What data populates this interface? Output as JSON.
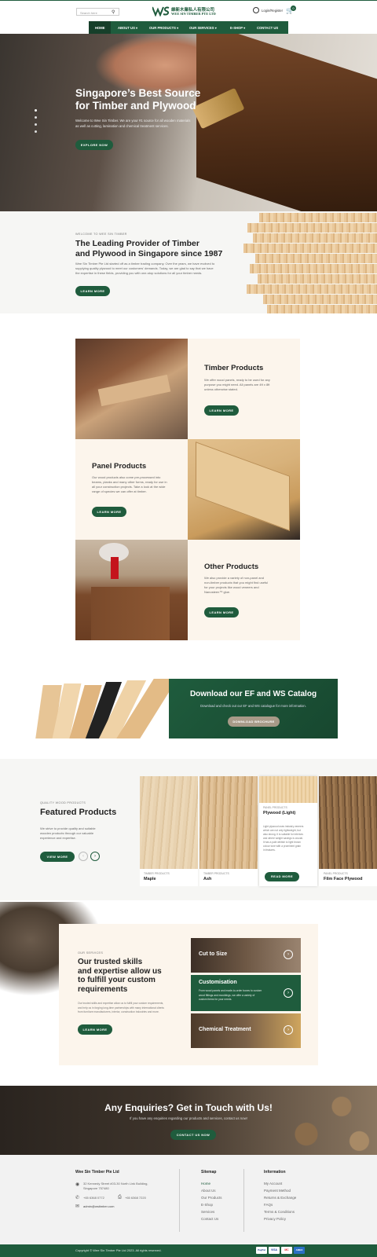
{
  "header": {
    "search_placeholder": "Search here",
    "logo_chinese": "維新木業私人有限公司",
    "logo_english": "WEE SIN TIMBER PTE LTD",
    "login_label": "Login/Register",
    "cart_count": "0"
  },
  "nav": {
    "items": [
      "HOME",
      "ABOUT US ▾",
      "OUR PRODUCTS ▾",
      "OUR SERVICES ▾",
      "E-SHOP ▾",
      "CONTACT US"
    ]
  },
  "hero": {
    "title_line1": "Singapore’s Best Source",
    "title_line2": "for Timber and Plywood",
    "subtitle_line1": "Welcome to Wee Sin Timber. We are your #1 source for all wooden materials",
    "subtitle_line2": "as well as cutting, lamination and chemical treatment services.",
    "cta": "EXPLORE NOW"
  },
  "welcome": {
    "eyebrow": "WELCOME TO WEE SIN TIMBER",
    "title_line1": "The Leading Provider of Timber",
    "title_line2": "and Plywood in Singapore since 1987",
    "body_line1": "Wee Sin Timber Pte Ltd started off as a timber trading company. Over the years, we have evolved to",
    "body_line2": "supplying quality plywood to meet our customers' demands. Today, we are glad to say that we have",
    "body_line3": "the expertise in these fields, providing you with one-stop solutions for all your timber needs.",
    "cta": "LEARN MORE"
  },
  "products": {
    "timber": {
      "title": "Timber Products",
      "line1": "We offer wood panels, ready to be used for any",
      "line2": "purpose you might need. All panels are 4ft x 8ft",
      "line3": "unless otherwise stated.",
      "cta": "LEARN MORE"
    },
    "panel": {
      "title": "Panel Products",
      "line1": "Our wood products also come pre-processed into",
      "line2": "beams, planks and many other forms, ready for use in",
      "line3": "all your construction projects. Take a look at the wide",
      "line4": "range of species we can offer at timber.",
      "cta": "LEARN MORE"
    },
    "other": {
      "title": "Other Products",
      "line1": "We also provide a variety of non-panel and",
      "line2": "non-timber products that you might find useful",
      "line3": "for your projects like wood veneers and",
      "line4": "Nanosteen™ glue.",
      "cta": "LEARN MORE"
    }
  },
  "catalog": {
    "title": "Download our EF and WS Catalog",
    "subtitle": "Download and check out our EF and WS catalogue for more information.",
    "cta": "DOWNLOAD BROCHURE"
  },
  "featured": {
    "eyebrow": "QUALITY WOOD PRODUCTS",
    "title": "Featured Products",
    "body_line1": "We strive to provide quality and suitable",
    "body_line2": "wooden products through our valuable",
    "body_line3": "experience and expertise.",
    "cta": "VIEW MORE",
    "cards": [
      {
        "category": "TIMBER PRODUCTS",
        "name": "Maple"
      },
      {
        "category": "TIMBER PRODUCTS",
        "name": "Ash"
      },
      {
        "category": "PANEL PRODUCTS",
        "name": "Plywood (Light)",
        "desc1": "Light plywood uses industry veneers",
        "desc2": "which are not only lightweight, but",
        "desc3": "also strong. It is suitable for interiors",
        "desc4": "and where weight savings is crucial.",
        "desc5": "It has a pale whitish to light brown",
        "desc6": "colour tone with a prominent grain",
        "desc7": "in features.",
        "cta": "READ MORE"
      },
      {
        "category": "PANEL PRODUCTS",
        "name": "Film Face Plywood"
      }
    ]
  },
  "services": {
    "eyebrow": "OUR SERVICES",
    "title_line1": "Our trusted skills",
    "title_line2": "and expertise allow us",
    "title_line3": "to fulfill your custom",
    "title_line4": "requirements",
    "body_line1": "Our trusted skills and expertise allow us to fulfill your custom requirements,",
    "body_line2": "and help us in forging long-time partnerships with many international clients",
    "body_line3": "from furniture manufacturers, interior, construction industries and more.",
    "cta": "LEARN MORE",
    "items": [
      {
        "title": "Cut to Size"
      },
      {
        "title": "Customisation",
        "line1": "From wood panels and made-to-order boxes to custom",
        "line2": "wood fittings and mouldings, we offer a variety of",
        "line3": "custom items for your needs."
      },
      {
        "title": "Chemical Treatment"
      }
    ]
  },
  "enquiry": {
    "title": "Any Enquiries? Get in Touch with Us!",
    "subtitle": "If you have any enquiries regarding our products and services, contact us now!",
    "cta": "CONTACT US NOW"
  },
  "footer": {
    "company": "Wee Sin Timber Pte Ltd",
    "address_line1": "32 Kennedy Street #03-30 North Link Building,",
    "address_line2": "Singapore 757480",
    "phone1": "+65 6368 0772",
    "phone2": "+65 6368 7220",
    "email": "admin@wstimber.com",
    "sitemap_title": "Sitemap",
    "sitemap": [
      "Home",
      "About Us",
      "Our Products",
      "E-Shop",
      "Services",
      "Contact Us"
    ],
    "info_title": "Information",
    "info": [
      "My Account",
      "Payment Method",
      "Returns & Exchange",
      "FAQs",
      "Terms & Conditions",
      "Privacy Policy"
    ],
    "copyright": "Copyright © Wee Sin Timber Pte Ltd 2023. All rights reserved.",
    "payments": [
      "PayPal",
      "VISA",
      "MC",
      "AMEX"
    ]
  },
  "colors": {
    "brand_green": "#1f5c3d",
    "cream": "#fcf5ec"
  }
}
